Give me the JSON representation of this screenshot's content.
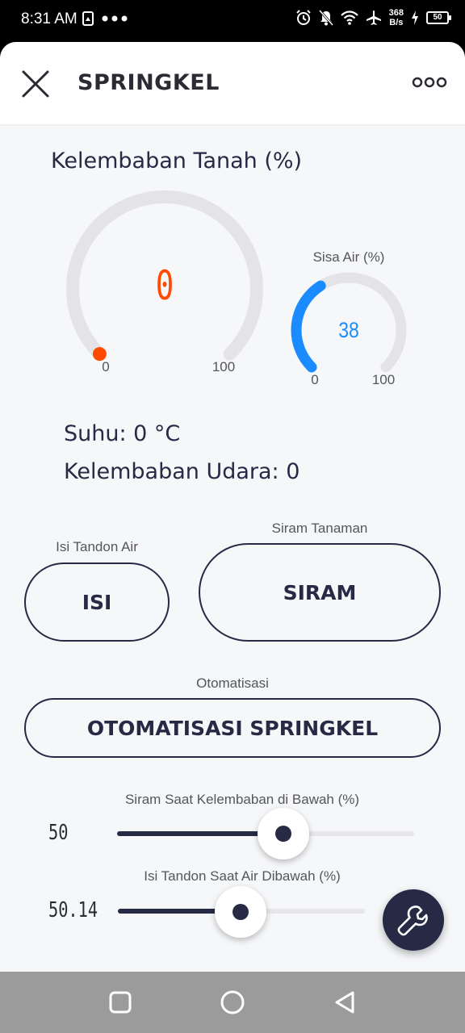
{
  "status_bar": {
    "time": "8:31 AM",
    "net_speed_value": "368",
    "net_speed_unit": "B/s",
    "battery": "50"
  },
  "header": {
    "title": "SPRINGKEL"
  },
  "soil_humidity": {
    "title": "Kelembaban Tanah (%)",
    "value": "0",
    "min": "0",
    "max": "100",
    "value_num": 0,
    "accent": "#ff4a00"
  },
  "water_remaining": {
    "title": "Sisa Air (%)",
    "value": "38",
    "min": "0",
    "max": "100",
    "value_num": 38,
    "accent": "#1a8cff"
  },
  "readings": {
    "temperature": "Suhu: 0 °C",
    "air_humidity": "Kelembaban Udara: 0"
  },
  "fill_tank": {
    "label": "Isi Tandon Air",
    "button": "ISI"
  },
  "water_plants": {
    "label": "Siram Tanaman",
    "button": "SIRAM"
  },
  "automation": {
    "label": "Otomatisasi",
    "button": "OTOMATISASI SPRINGKEL"
  },
  "slider_water_below": {
    "label": "Siram Saat Kelembaban di Bawah (%)",
    "value": "50",
    "fraction": 0.5
  },
  "slider_tank_below": {
    "label": "Isi Tandon Saat Air Dibawah (%)",
    "value": "50.14",
    "fraction": 0.5014
  },
  "colors": {
    "primary": "#272a45",
    "track": "#e4e4e6"
  },
  "icons": {
    "close": "close-icon",
    "more": "more-horizontal-icon",
    "fab": "wrench-icon",
    "nav_recent": "square-icon",
    "nav_home": "circle-icon",
    "nav_back": "triangle-back-icon"
  }
}
